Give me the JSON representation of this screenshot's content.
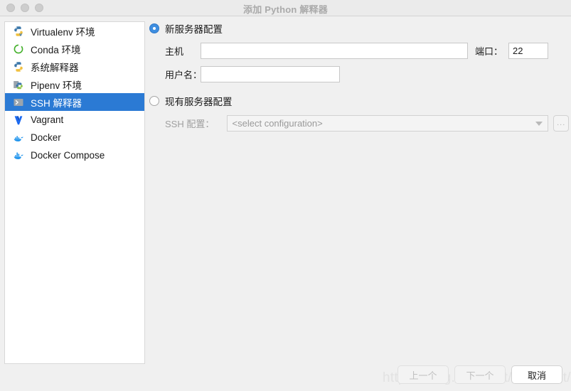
{
  "window": {
    "title": "添加 Python 解释器",
    "controls": [
      "close",
      "minimize",
      "zoom"
    ]
  },
  "sidebar": {
    "items": [
      {
        "label": "Virtualenv 环境",
        "icon": "python-virtualenv-icon",
        "selected": false
      },
      {
        "label": "Conda 环境",
        "icon": "conda-icon",
        "selected": false
      },
      {
        "label": "系统解释器",
        "icon": "python-icon",
        "selected": false
      },
      {
        "label": "Pipenv 环境",
        "icon": "pipenv-icon",
        "selected": false
      },
      {
        "label": "SSH 解释器",
        "icon": "ssh-terminal-icon",
        "selected": true
      },
      {
        "label": "Vagrant",
        "icon": "vagrant-icon",
        "selected": false
      },
      {
        "label": "Docker",
        "icon": "docker-icon",
        "selected": false
      },
      {
        "label": "Docker Compose",
        "icon": "docker-compose-icon",
        "selected": false
      }
    ]
  },
  "main": {
    "new_server": {
      "radio_label": "新服务器配置",
      "selected": true,
      "host": {
        "label": "主机",
        "value": "",
        "placeholder": ""
      },
      "port": {
        "label": "端口：",
        "value": "22"
      },
      "username": {
        "label": "用户名：",
        "value": "",
        "placeholder": ""
      }
    },
    "existing_server": {
      "radio_label": "现有服务器配置",
      "selected": false,
      "ssh_config": {
        "label": "SSH 配置：",
        "value": "<select configuration>",
        "browse_label": "..."
      }
    }
  },
  "footer": {
    "previous_label": "上一个",
    "next_label": "下一个",
    "cancel_label": "取消"
  },
  "watermark": "https://blog.csdn.net/Jameslvt/huker",
  "colors": {
    "accent": "#2b7ad4",
    "radio_on": "#3e8ee0",
    "window_bg": "#f0f0f0",
    "panel_bg": "#ffffff"
  }
}
